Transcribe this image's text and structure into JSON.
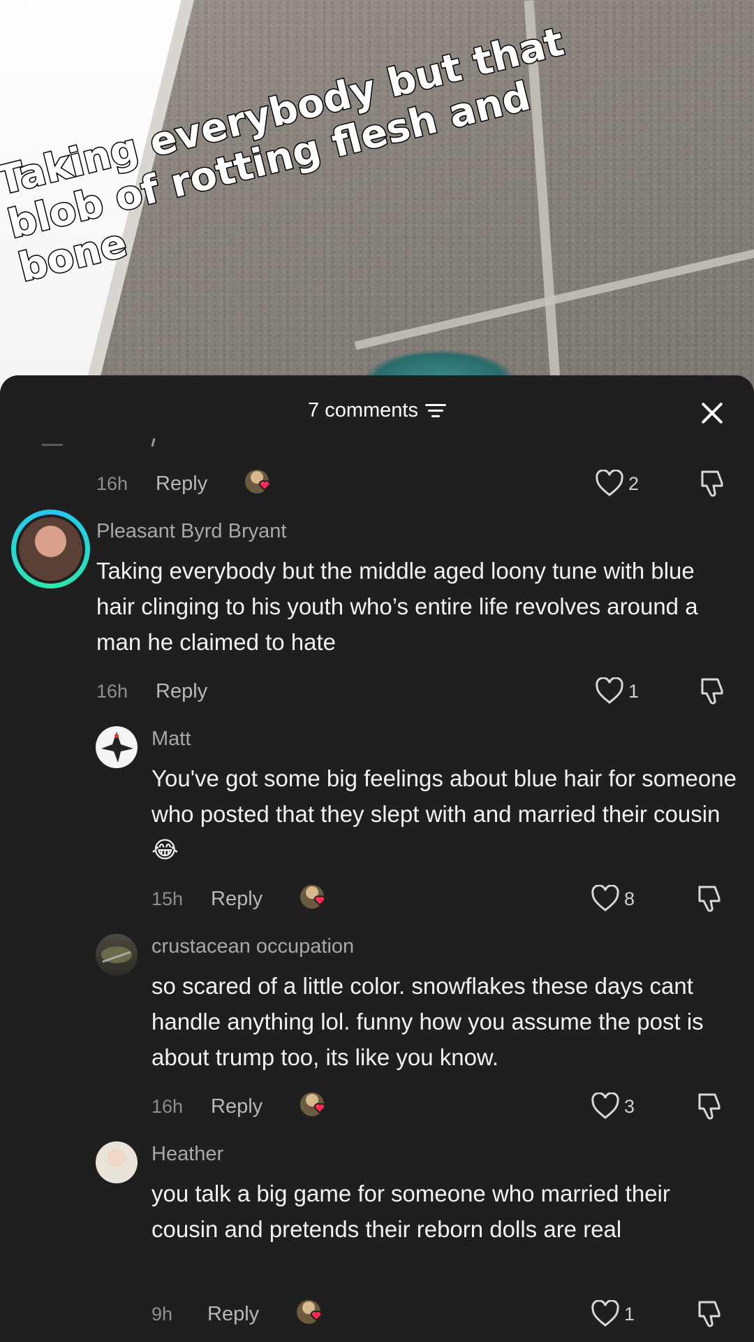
{
  "video": {
    "caption": "Taking everybody but that\nblob of rotting flesh and\nbone"
  },
  "sheet": {
    "title": "7 comments",
    "partial_comment": {
      "time": "16h",
      "reply_label": "Reply",
      "likes": "2"
    },
    "comments": [
      {
        "author": "Pleasant Byrd Bryant",
        "text": "Taking everybody but the middle aged loony tune with blue hair clinging to his youth who’s entire life revolves around a man he claimed to hate",
        "time": "16h",
        "reply_label": "Reply",
        "likes": "1",
        "creator_liked": false
      },
      {
        "author": "Matt",
        "text": "You've got some big feelings about blue hair for someone who posted that they slept with and married their cousin 😂",
        "time": "15h",
        "reply_label": "Reply",
        "likes": "8",
        "creator_liked": true
      },
      {
        "author": "crustacean occupation",
        "text": "so scared of a little color. snowflakes these days cant handle anything lol. funny how you assume the post is about trump too, its like you know.",
        "time": "16h",
        "reply_label": "Reply",
        "likes": "3",
        "creator_liked": true
      },
      {
        "author": "Heather",
        "text": "you talk a big game for someone who married their cousin and pretends their reborn dolls are real",
        "time": "9h",
        "reply_label": "Reply",
        "likes": "1",
        "creator_liked": true
      }
    ]
  },
  "colors": {
    "sheet_bg": "#1f1f1f",
    "story_ring_start": "#27c4f5",
    "story_ring_end": "#2fe8a5",
    "heart_red": "#fe2c55"
  },
  "icons": [
    "back-arrow-icon",
    "sort-icon",
    "close-icon",
    "heart-outline-icon",
    "dislike-icon",
    "creator-liked-heart-icon"
  ]
}
